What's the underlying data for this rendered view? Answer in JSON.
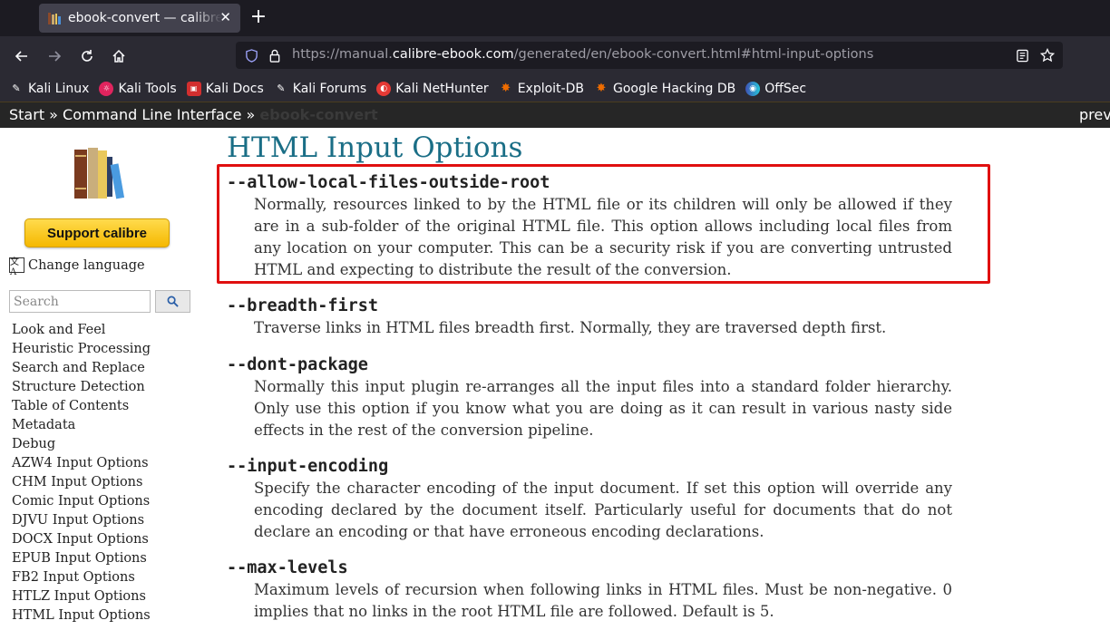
{
  "browser": {
    "tab": {
      "title": "ebook-convert — calibre User Manual",
      "close_glyph": "✕",
      "favicon": "calibre-books-icon"
    },
    "new_tab_glyph": "+",
    "nav": {
      "back": "arrow-left-icon",
      "forward": "arrow-right-icon",
      "reload": "reload-icon",
      "home": "home-icon"
    },
    "url": {
      "prefix": "https://manual.",
      "domain": "calibre-ebook.com",
      "path": "/generated/en/ebook-convert.html#html-input-options"
    },
    "bookmarks": [
      {
        "label": "Kali Linux",
        "icon": "kali-dragon-icon",
        "color": "#ffffff"
      },
      {
        "label": "Kali Tools",
        "icon": "kali-tools-icon",
        "color": "#e0245e"
      },
      {
        "label": "Kali Docs",
        "icon": "kali-docs-icon",
        "color": "#d32f2f"
      },
      {
        "label": "Kali Forums",
        "icon": "kali-forums-icon",
        "color": "#ffffff"
      },
      {
        "label": "Kali NetHunter",
        "icon": "nethunter-icon",
        "color": "#e53935"
      },
      {
        "label": "Exploit-DB",
        "icon": "exploit-db-icon",
        "color": "#ef6c00"
      },
      {
        "label": "Google Hacking DB",
        "icon": "ghdb-icon",
        "color": "#ef6c00"
      },
      {
        "label": "OffSec",
        "icon": "offsec-icon",
        "color": "#3f51b5"
      }
    ]
  },
  "relbar": {
    "crumbs": "Start » Command Line Interface » ",
    "current": "ebook-convert",
    "prev": "previous"
  },
  "sidebar": {
    "support_label": "Support calibre",
    "language_label": "Change language",
    "search_placeholder": "Search",
    "toc": [
      "Look and Feel",
      "Heuristic Processing",
      "Search and Replace",
      "Structure Detection",
      "Table of Contents",
      "Metadata",
      "Debug",
      "AZW4 Input Options",
      "CHM Input Options",
      "Comic Input Options",
      "DJVU Input Options",
      "DOCX Input Options",
      "EPUB Input Options",
      "FB2 Input Options",
      "HTLZ Input Options",
      "HTML Input Options"
    ]
  },
  "main": {
    "title": "HTML Input Options",
    "options": [
      {
        "name": "--allow-local-files-outside-root",
        "desc": "Normally, resources linked to by the HTML file or its children will only be allowed if they are in a sub-folder of the original HTML file. This option allows including local files from any location on your computer. This can be a security risk if you are converting untrusted HTML and expecting to distribute the result of the conversion."
      },
      {
        "name": "--breadth-first",
        "desc": "Traverse links in HTML files breadth first. Normally, they are traversed depth first."
      },
      {
        "name": "--dont-package",
        "desc": "Normally this input plugin re-arranges all the input files into a standard folder hierarchy. Only use this option if you know what you are doing as it can result in various nasty side effects in the rest of the conversion pipeline."
      },
      {
        "name": "--input-encoding",
        "desc": "Specify the character encoding of the input document. If set this option will override any encoding declared by the document itself. Particularly useful for documents that do not declare an encoding or that have erroneous encoding declarations."
      },
      {
        "name": "--max-levels",
        "desc": "Maximum levels of recursion when following links in HTML files. Must be non-negative. 0 implies that no links in the root HTML file are followed. Default is 5."
      }
    ]
  }
}
